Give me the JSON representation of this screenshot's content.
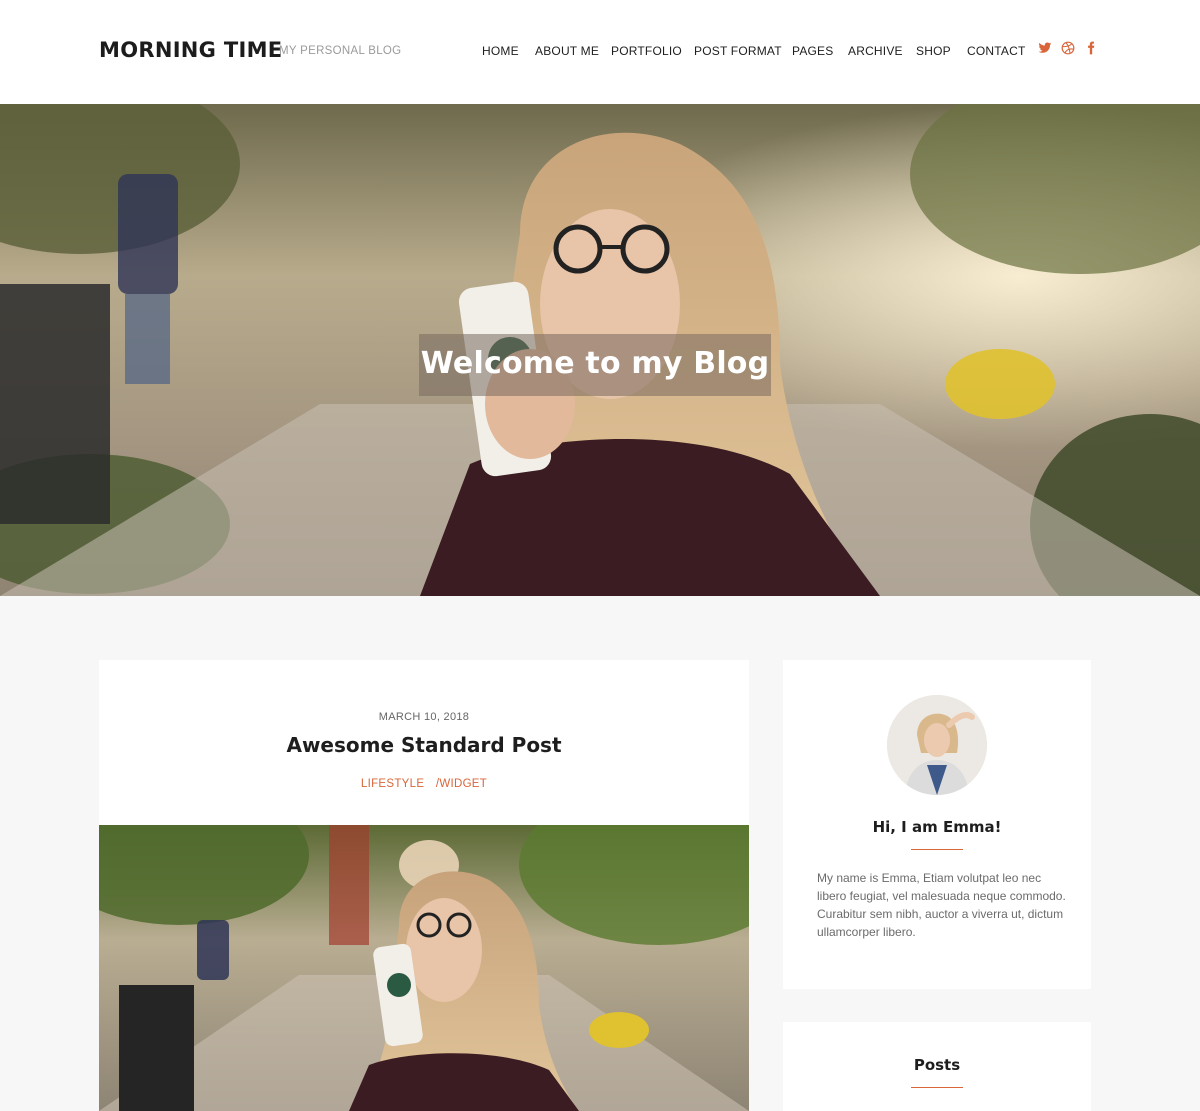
{
  "header": {
    "site_title": "MORNING TIME",
    "tagline": "MY PERSONAL BLOG",
    "nav": [
      "HOME",
      "ABOUT ME",
      "PORTFOLIO",
      "POST FORMAT",
      "PAGES",
      "ARCHIVE",
      "SHOP",
      "CONTACT"
    ],
    "social_icons": [
      "twitter-icon",
      "dribbble-icon",
      "facebook-icon"
    ]
  },
  "hero": {
    "title": "Welcome to my Blog"
  },
  "post": {
    "date": "MARCH 10, 2018",
    "title": "Awesome Standard Post",
    "category_1": "LIFESTYLE",
    "category_separator": "/",
    "category_2": "WIDGET"
  },
  "sidebar": {
    "about": {
      "title": "Hi, I am Emma!",
      "text": "My name is Emma, Etiam volutpat leo nec libero feugiat, vel malesuada neque commodo. Curabitur sem nibh, auctor a viverra ut, dictum ullamcorper libero."
    },
    "posts": {
      "title": "Posts"
    }
  },
  "colors": {
    "accent": "#d9653a",
    "background": "#f7f7f7"
  }
}
